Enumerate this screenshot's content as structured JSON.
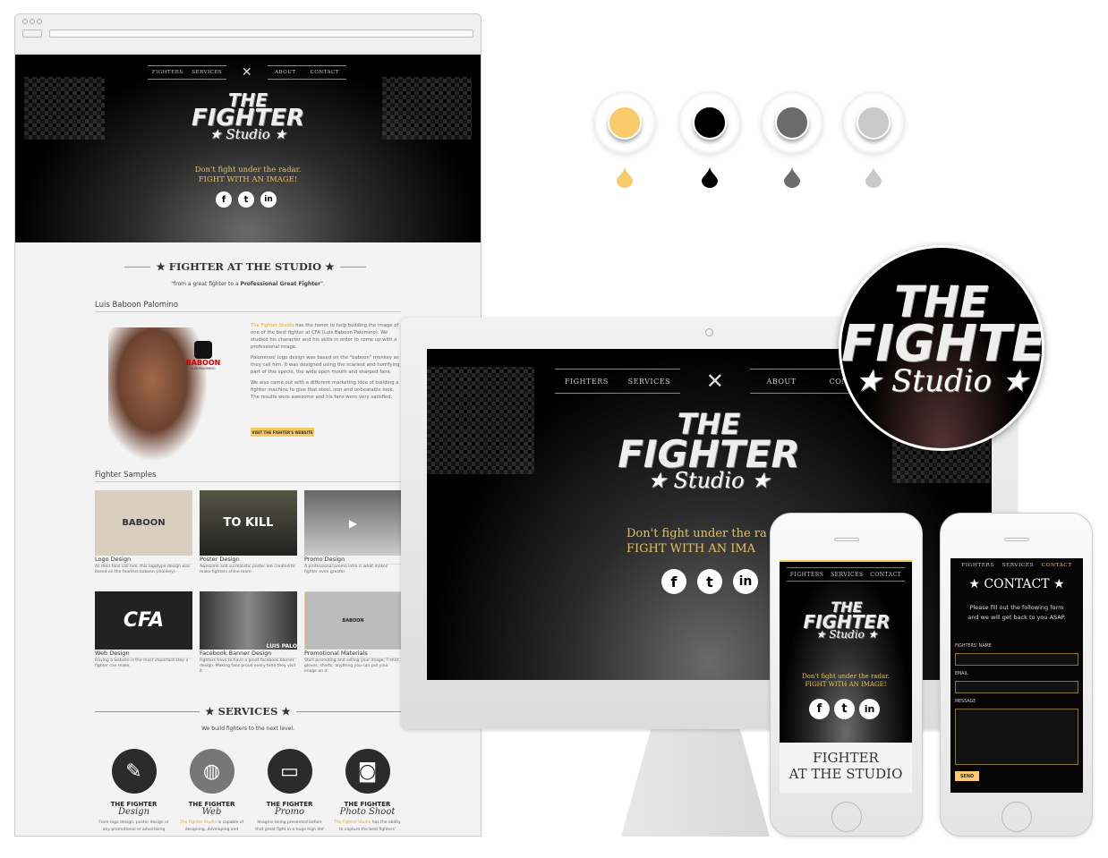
{
  "palette": {
    "colors": [
      "#f9cb6b",
      "#000000",
      "#6b6b6b",
      "#c9c9c9"
    ]
  },
  "site": {
    "nav": {
      "fighters": "FIGHTERS",
      "services": "SERVICES",
      "about": "ABOUT",
      "contact": "CONTACT",
      "contact_clipped": "CONTA"
    },
    "logo": {
      "line1": "THE",
      "line2": "FIGHTER",
      "line3": "Studio"
    },
    "tagline": {
      "line1": "Don't fight under the radar.",
      "line2": "FIGHT WITH AN IMAGE!",
      "line1_clipped": "Don't fight under the ra",
      "line2_clipped": "FIGHT WITH AN IMA"
    },
    "social": {
      "facebook": "f",
      "twitter": "t",
      "linkedin": "in"
    },
    "fighter_section": {
      "title": "FIGHTER AT THE STUDIO",
      "quote_pre": "\"from a great fighter to a ",
      "quote_bold": "Professional Great Fighter",
      "quote_post": "\".",
      "fighter_name": "Luis Baboon Palomino",
      "brand_logo": "BABOON",
      "brand_sub": "LUIS PALOMINO",
      "p1_highlight": "The Fighter Studio",
      "p1": " has the honor to help building the image of one of the best fighter at CFA (Luis Baboon Palomino). We studied his character and his skills in order to come up with a professional image.",
      "p2": "Palominos' logo design was based on the \"baboon\" monkey as they call him. It was designed using the scariest and horrifying part of this specie, the wide open mouth and sharped fans.",
      "p3": "We also came out with a different marketing idea of building a fighter machine to give that steel, iron and unbeatable look. The results were awesome and his fans were very satisfied.",
      "button": "VISIT THE FIGHTER'S WEBSITE"
    },
    "samples": {
      "title": "Fighter Samples",
      "items": [
        {
          "thumb": "BABOON",
          "caption": "Logo Design",
          "desc": "As their fans call him, this logotype design was based on the fearless baboon (monkey)."
        },
        {
          "thumb": "TO KILL",
          "caption": "Poster Design",
          "desc": "Awesome and surrealistic poster are created to make fighters shine more."
        },
        {
          "thumb": "▶",
          "caption": "Promo Design",
          "desc": "A professional promo intro is what makes fighter even greater."
        },
        {
          "thumb": "CFA",
          "caption": "Web Design",
          "desc": "Having a website is the most important step a fighter can make."
        },
        {
          "thumb": "LUIS PALO",
          "caption": "Facebook Banner Design",
          "desc": "Fighters have to have a great facebook banner design. Making fans proud every time they visit it."
        },
        {
          "thumb": "BABOON",
          "caption": "Promotional Materials",
          "desc": "Start promoting and selling your image; T-shirt, gloves, shorts; anything you can put your image on it."
        }
      ]
    },
    "services": {
      "title": "SERVICES",
      "subtitle": "We build fighters to the next level.",
      "items": [
        {
          "icon": "brush-icon",
          "glyph": "✎",
          "title": "THE FIGHTER",
          "script": "Design",
          "desc_hl": "",
          "desc": "From logo design, poster design or any promotional or advertising"
        },
        {
          "icon": "globe-icon",
          "glyph": "◍",
          "title": "THE FIGHTER",
          "script": "Web",
          "desc_hl": "The Fighter Studio",
          "desc": " is capable of designing, developing and"
        },
        {
          "icon": "clapper-icon",
          "glyph": "▭",
          "title": "THE FIGHTER",
          "script": "Promo",
          "desc_hl": "",
          "desc": "Imagine being presented before that great fight in a huge high def"
        },
        {
          "icon": "camera-icon",
          "glyph": "◙",
          "title": "THE FIGHTER",
          "script": "Photo Shoot",
          "desc_hl": "The Fighter Studio",
          "desc": " has the ability to capture the best fighters'"
        }
      ]
    },
    "mobile_section_title": {
      "line1": "FIGHTER",
      "line2": "AT THE STUDIO"
    },
    "contact": {
      "title": "CONTACT",
      "intro_line1": "Please fill out the following form",
      "intro_line2": "and we will get back to you ASAP.",
      "name_label": "FIGHTERS' NAME",
      "email_label": "EMAIL",
      "message_label": "MESSAGE",
      "name_value": "",
      "email_value": "",
      "message_value": "",
      "send": "SEND"
    }
  }
}
